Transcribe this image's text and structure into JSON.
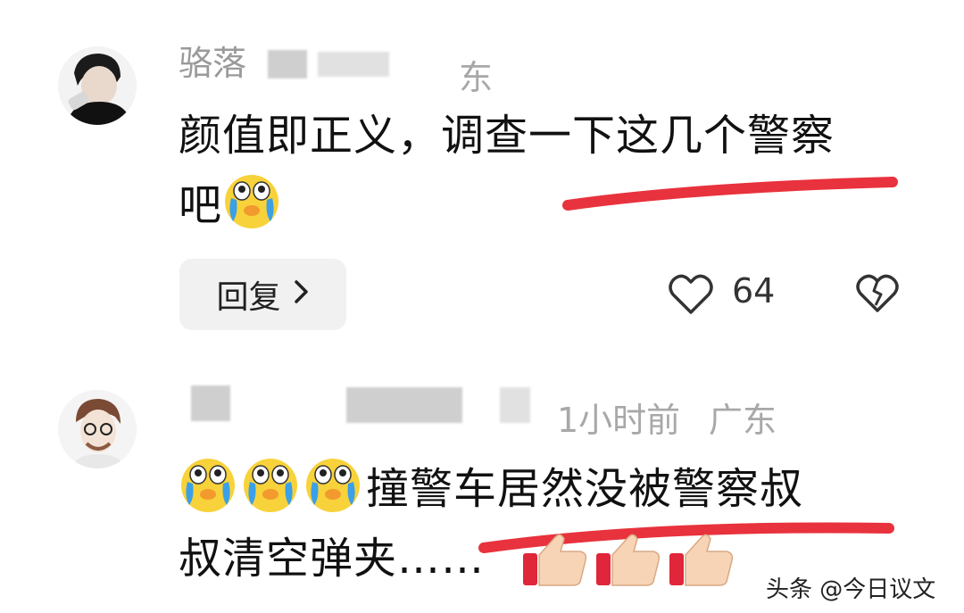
{
  "comments": [
    {
      "username_visible": "骆落",
      "location_fragment": "东",
      "text_line1": "颜值即正义，调查一下这几个警察",
      "text_line2": "吧",
      "reply_label": "回复",
      "like_count": "64",
      "emoji_count": 1
    },
    {
      "time": "1小时前",
      "location": "广东",
      "text_line1": "撞警车居然没被警察叔",
      "text_line2": "叔清空弹夹……",
      "emoji_count": 3
    }
  ],
  "watermark": "头条 @今日议文",
  "colors": {
    "underline": "#e8323d",
    "emoji_face": "#f8d23a",
    "tear": "#3aa0e8"
  },
  "icons": [
    "heart-icon",
    "broken-heart-icon",
    "chevron-right-icon",
    "crying-emoji-icon",
    "thumbs-up-icon"
  ]
}
